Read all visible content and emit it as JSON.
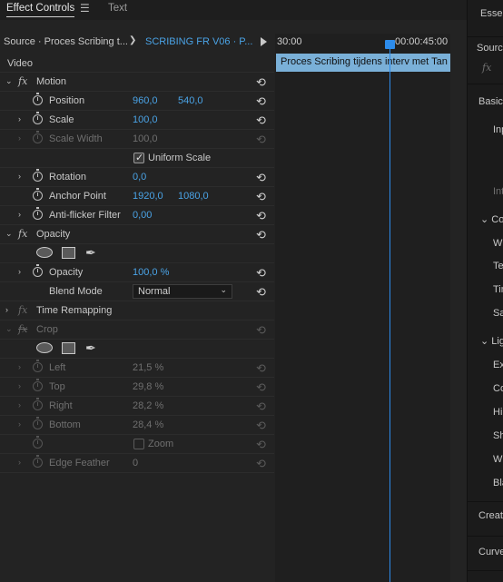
{
  "tabs": {
    "active": "Effect Controls",
    "inactive": "Text"
  },
  "source": {
    "source_label": "Source · Proces Scribing t...",
    "clip_label": "SCRIBING FR V06 · P..."
  },
  "timeline": {
    "time_start": "30:00",
    "time_end": "00:00:45:00",
    "clip_name": "Proces Scribing tijdens interv met Tan"
  },
  "sections": {
    "video": "Video",
    "motion": "Motion",
    "opacity": "Opacity",
    "time_remapping": "Time Remapping",
    "crop": "Crop"
  },
  "fx_symbol": "fx",
  "motion": {
    "position": {
      "label": "Position",
      "x": "960,0",
      "y": "540,0"
    },
    "scale": {
      "label": "Scale",
      "value": "100,0"
    },
    "scale_width": {
      "label": "Scale Width",
      "value": "100,0"
    },
    "uniform_scale": {
      "label": "Uniform Scale",
      "checked": true
    },
    "rotation": {
      "label": "Rotation",
      "value": "0,0"
    },
    "anchor_point": {
      "label": "Anchor Point",
      "x": "1920,0",
      "y": "1080,0"
    },
    "anti_flicker": {
      "label": "Anti-flicker Filter",
      "value": "0,00"
    }
  },
  "opacity": {
    "opacity": {
      "label": "Opacity",
      "value": "100,0 %"
    },
    "blend_mode": {
      "label": "Blend Mode",
      "value": "Normal"
    }
  },
  "crop": {
    "left": {
      "label": "Left",
      "value": "21,5 %"
    },
    "top": {
      "label": "Top",
      "value": "29,8 %"
    },
    "right": {
      "label": "Right",
      "value": "28,2 %"
    },
    "bottom": {
      "label": "Bottom",
      "value": "28,4 %"
    },
    "zoom": {
      "label": "Zoom",
      "checked": false
    },
    "edge_feather": {
      "label": "Edge Feather",
      "value": "0"
    }
  },
  "right_panel": {
    "tab": "Essen",
    "source": "Source",
    "fx": "fx",
    "basic": "Basic",
    "inp": "Inp",
    "int": "Int",
    "co": "Co",
    "wh": "Wh",
    "te": "Te",
    "tin": "Tin",
    "sa": "Sa",
    "lig": "Lig",
    "ex": "Ex",
    "co2": "Co",
    "hi": "Hi",
    "sh": "Sh",
    "wh2": "Wh",
    "bla": "Bla",
    "creati": "Creati",
    "curve": "Curve"
  },
  "colors": {
    "accent": "#2d8ceb",
    "value_blue": "#4aa3e6",
    "clip_bar": "#7ab0d8"
  }
}
